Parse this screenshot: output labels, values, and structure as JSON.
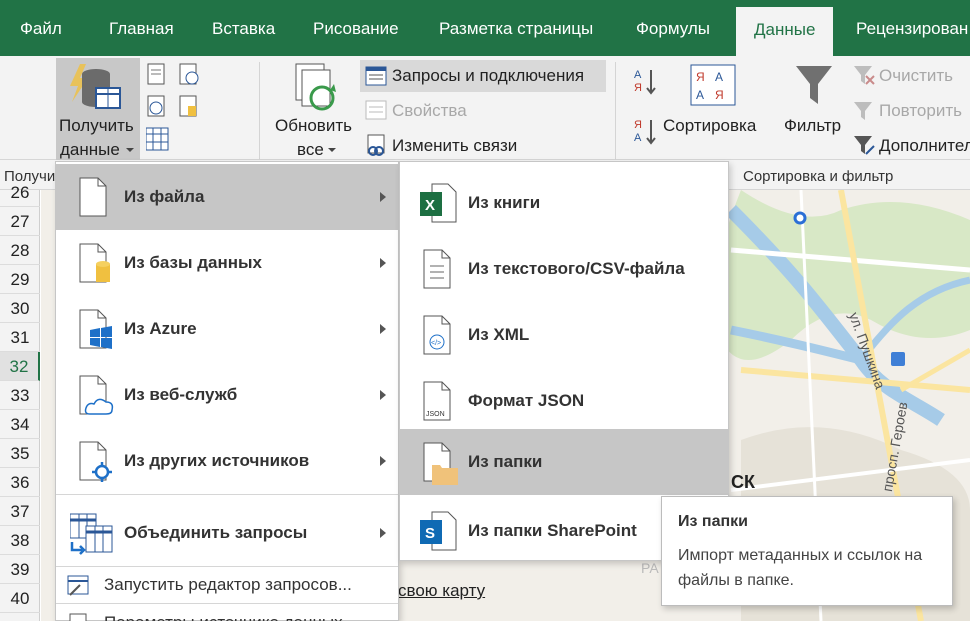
{
  "tabs": [
    "Файл",
    "Главная",
    "Вставка",
    "Рисование",
    "Разметка страницы",
    "Формулы",
    "Данные",
    "Рецензирован"
  ],
  "active_tab": "Данные",
  "ribbon": {
    "get_data": {
      "line1": "Получить",
      "line2": "данные"
    },
    "refresh": {
      "line1": "Обновить",
      "line2": "все"
    },
    "queries_connections": "Запросы и подключения",
    "properties": "Свойства",
    "edit_links": "Изменить связи",
    "sort": "Сортировка",
    "filter": "Фильтр",
    "clear": "Очистить",
    "reapply": "Повторить",
    "advanced": "Дополнительно",
    "group_get": "Получи",
    "group_sort_filter": "Сортировка и фильтр"
  },
  "rows": [
    "26",
    "27",
    "28",
    "29",
    "30",
    "31",
    "32",
    "33",
    "34",
    "35",
    "36",
    "37",
    "38",
    "39",
    "40"
  ],
  "selected_row": "32",
  "menu_main": {
    "items": [
      {
        "label": "Из файла",
        "icon": "file-icon"
      },
      {
        "label": "Из базы данных",
        "icon": "database-icon"
      },
      {
        "label": "Из Azure",
        "icon": "azure-icon"
      },
      {
        "label": "Из веб-служб",
        "icon": "cloud-icon"
      },
      {
        "label": "Из других источников",
        "icon": "other-sources-icon"
      },
      {
        "label": "Объединить запросы",
        "icon": "combine-icon"
      }
    ],
    "bottom": [
      "Запустить редактор запросов...",
      "Параметры источника данных..."
    ]
  },
  "menu_file": {
    "items": [
      {
        "label": "Из книги",
        "icon": "excel-icon"
      },
      {
        "label": "Из текстового/CSV-файла",
        "icon": "text-file-icon"
      },
      {
        "label": "Из XML",
        "icon": "xml-icon"
      },
      {
        "label": "Формат JSON",
        "icon": "json-icon"
      },
      {
        "label": "Из папки",
        "icon": "folder-icon"
      },
      {
        "label": "Из папки SharePoint",
        "icon": "sharepoint-icon"
      }
    ]
  },
  "tooltip": {
    "title": "Из папки",
    "body": "Импорт метаданных и ссылок на файлы в папке."
  },
  "map": {
    "street1": "ул. Пушкина",
    "street2": "просп. Героев",
    "city_fragment": "СК",
    "link": "свою карту",
    "letters": "РА"
  },
  "colors": {
    "excel_green": "#217346",
    "menu_highlight": "#c6c6c6"
  }
}
